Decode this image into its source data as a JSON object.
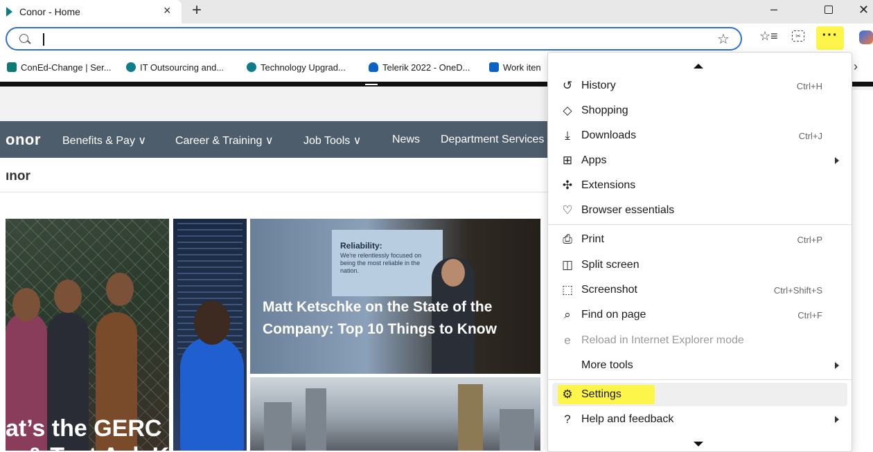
{
  "browser": {
    "tab_title": "Conor - Home",
    "tab_close": "×",
    "new_tab": "+",
    "window": {
      "minimize": "–",
      "close": "✕"
    },
    "address_value": "",
    "more_label": "···"
  },
  "favorites": [
    {
      "label": "ConEd-Change | Ser...",
      "color": "#0a7a73",
      "icon": "coned-icon"
    },
    {
      "label": "IT Outsourcing and...",
      "color": "#0f7c8a",
      "icon": "sharepoint-icon"
    },
    {
      "label": "Technology Upgrad...",
      "color": "#0f7c8a",
      "icon": "sharepoint-icon"
    },
    {
      "label": "Telerik 2022 - OneD...",
      "color": "#0b62c4",
      "icon": "onedrive-icon"
    },
    {
      "label": "Work iten",
      "color": "#0b62c4",
      "icon": "azure-devops-icon"
    }
  ],
  "site": {
    "logo": "onor",
    "nav": [
      "Benefits & Pay ∨",
      "Career & Training ∨",
      "Job Tools ∨",
      "News",
      "Department Services"
    ],
    "breadcrumb": "ınor",
    "card_a_title_line1": "at’s the GERC",
    "card_a_title_line2": "o & Test Ask K",
    "card_c_slide_head": "Reliability:",
    "card_c_slide_body": "We're relentlessly focused on being the most reliable in the nation.",
    "card_c_title": "Matt Ketschke on the State of the Company: Top 10 Things to Know"
  },
  "menu": {
    "items": [
      {
        "label": "History",
        "shortcut": "Ctrl+H",
        "icon": "history-icon",
        "glyph": "↺",
        "submenu": false
      },
      {
        "label": "Shopping",
        "shortcut": "",
        "icon": "shopping-tag-icon",
        "glyph": "◇",
        "submenu": false
      },
      {
        "label": "Downloads",
        "shortcut": "Ctrl+J",
        "icon": "download-icon",
        "glyph": "⤓",
        "submenu": false
      },
      {
        "label": "Apps",
        "shortcut": "",
        "icon": "apps-icon",
        "glyph": "⊞",
        "submenu": true
      },
      {
        "label": "Extensions",
        "shortcut": "",
        "icon": "extensions-icon",
        "glyph": "✣",
        "submenu": false
      },
      {
        "label": "Browser essentials",
        "shortcut": "",
        "icon": "heartbeat-icon",
        "glyph": "♡",
        "submenu": false
      },
      {
        "label": "Print",
        "shortcut": "Ctrl+P",
        "icon": "print-icon",
        "glyph": "⎙",
        "submenu": false
      },
      {
        "label": "Split screen",
        "shortcut": "",
        "icon": "split-screen-icon",
        "glyph": "◫",
        "submenu": false
      },
      {
        "label": "Screenshot",
        "shortcut": "Ctrl+Shift+S",
        "icon": "screenshot-icon",
        "glyph": "⬚",
        "submenu": false
      },
      {
        "label": "Find on page",
        "shortcut": "Ctrl+F",
        "icon": "find-icon",
        "glyph": "⌕",
        "submenu": false
      },
      {
        "label": "Reload in Internet Explorer mode",
        "shortcut": "",
        "icon": "ie-icon",
        "glyph": "e",
        "submenu": false,
        "disabled": true
      },
      {
        "label": "More tools",
        "shortcut": "",
        "icon": "",
        "glyph": "",
        "submenu": true
      },
      {
        "label": "Settings",
        "shortcut": "",
        "icon": "gear-icon",
        "glyph": "⚙",
        "submenu": false,
        "highlighted": true
      },
      {
        "label": "Help and feedback",
        "shortcut": "",
        "icon": "help-icon",
        "glyph": "?",
        "submenu": true
      }
    ],
    "highlight_color": "#fdf54a"
  }
}
